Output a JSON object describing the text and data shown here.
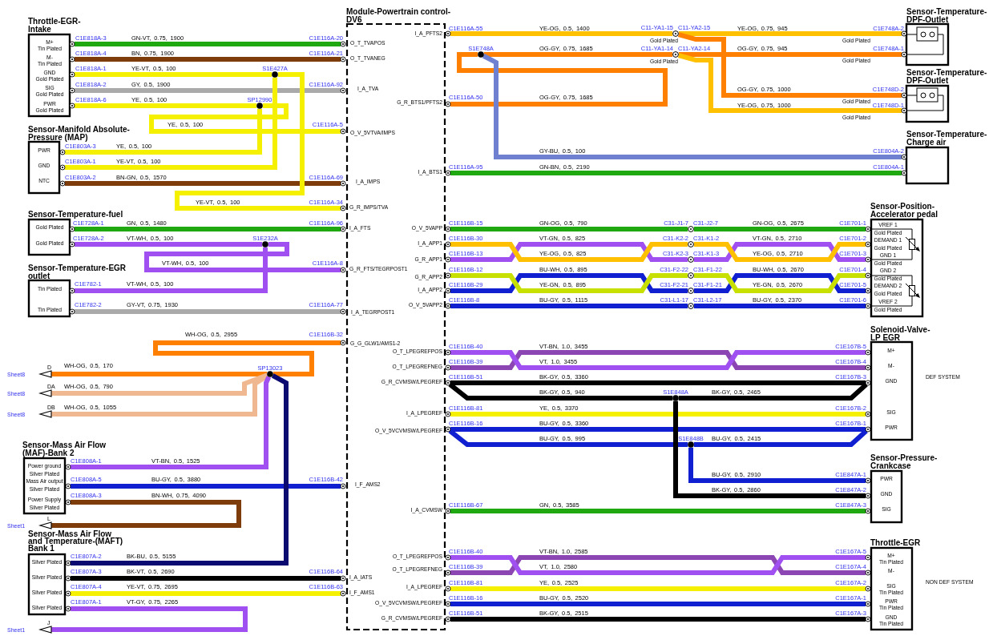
{
  "module": {
    "title_lines": [
      "Module-Powertrain control-",
      "DV6"
    ],
    "left_pins": [
      "O_T_TVAPOS",
      "O_T_TVANEG",
      "I_A_TVA",
      "O_V_5VTVA/IMPS",
      "I_A_IMPS",
      "G_R_IMPS/TVA",
      "I_A_FTS",
      "G_R_FTS/TEGRPOST1",
      "I_A_TEGRPOST1",
      "G_G_GLW1/AMS1-2",
      "I_F_AMS2",
      "I_A_IATS",
      "I_F_AMS1"
    ],
    "right_pins": [
      "I_A_PFTS2",
      "G_R_BTS1/PFTS2",
      "I_A_BTS1",
      "O_V_5VAPP",
      "I_A_APP1",
      "G_R_APP1",
      "G_R_APP2",
      "I_A_APP2",
      "O_V_5VAPP2",
      "O_T_LPEGREFPOS",
      "O_T_LPEGREFNEG",
      "G_R_CVMSW/LPEGREF",
      "I_A_LPEGREF",
      "O_V_5VCVMSW/LPEGREF",
      "I_A_CVMSW",
      "O_T_LPEGREFPOS",
      "O_T_LPEGREFNEG",
      "I_A_LPEGREF",
      "O_V_5VCVMSW/LPEGREF",
      "G_R_CVMSW/LPEGREF"
    ]
  },
  "components": [
    {
      "title_lines": [
        "Throttle-EGR-",
        "Intake"
      ],
      "pins": [
        {
          "name": "M+",
          "plating": "Tin Plated"
        },
        {
          "name": "M-",
          "plating": "Tin Plated"
        },
        {
          "name": "GND",
          "plating": "Gold Plated"
        },
        {
          "name": "SIG",
          "plating": "Gold Plated"
        },
        {
          "name": "PWR",
          "plating": "Gold Plated"
        }
      ]
    },
    {
      "title_lines": [
        "Sensor-Manifold Absolute-",
        "Pressure (MAP)"
      ],
      "pins": [
        {
          "name": "PWR"
        },
        {
          "name": "GND"
        },
        {
          "name": "NTC"
        }
      ]
    },
    {
      "title_lines": [
        "Sensor-Temperature-fuel"
      ],
      "pins": [
        {
          "plating": "Gold Plated"
        },
        {
          "plating": "Gold Plated"
        }
      ]
    },
    {
      "title_lines": [
        "Sensor-Temperature-EGR",
        "outlet"
      ],
      "pins": [
        {
          "plating": "Tin Plated"
        },
        {
          "plating": "Tin Plated"
        }
      ]
    },
    {
      "title_lines": [
        "Sensor-Mass Air Flow",
        "(MAF)-Bank 2"
      ],
      "pins": [
        {
          "name": "Power ground",
          "plating": "Silver Plated"
        },
        {
          "name": "Mass Air output",
          "plating": "Silver Plated"
        },
        {
          "name": "Power Supply",
          "plating": "Silver Plated"
        }
      ]
    },
    {
      "title_lines": [
        "Sensor-Mass Air Flow",
        "and Temperature-(MAFT)",
        "Bank 1"
      ],
      "pins": [
        {
          "plating": "Silver Plated"
        },
        {
          "plating": "Silver Plated"
        },
        {
          "plating": "Silver Plated"
        },
        {
          "plating": "Silver Plated"
        }
      ]
    },
    {
      "title_lines": [
        "Sensor-Temperature-",
        "DPF-Outlet"
      ]
    },
    {
      "title_lines": [
        "Sensor-Temperature-",
        "DPF-Outlet"
      ]
    },
    {
      "title_lines": [
        "Sensor-Temperature-",
        "Charge air"
      ]
    },
    {
      "title_lines": [
        "Sensor-Position-",
        "Accelerator pedal"
      ],
      "pins": [
        {
          "name": "VREF 1",
          "plating": "Gold Plated"
        },
        {
          "name": "DEMAND 1",
          "plating": "Gold Plated"
        },
        {
          "name": "GND 1",
          "plating": "Gold Plated"
        },
        {
          "name": "GND 2",
          "plating": "Gold Plated"
        },
        {
          "name": "DEMAND 2",
          "plating": "Gold Plated"
        },
        {
          "name": "VREF 2",
          "plating": "Gold Plated"
        }
      ]
    },
    {
      "title_lines": [
        "Solenoid-Valve-",
        "LP EGR"
      ],
      "pins": [
        {
          "name": "M+"
        },
        {
          "name": "M-"
        },
        {
          "name": "GND"
        },
        {
          "name": "SIG"
        },
        {
          "name": "PWR"
        }
      ],
      "note": "DEF SYSTEM"
    },
    {
      "title_lines": [
        "Sensor-Pressure-",
        "Crankcase"
      ],
      "pins": [
        {
          "name": "PWR"
        },
        {
          "name": "GND"
        },
        {
          "name": "SIG"
        }
      ]
    },
    {
      "title_lines": [
        "Throttle-EGR"
      ],
      "pins": [
        {
          "name": "M+",
          "plating": "Tin Plated"
        },
        {
          "name": "M-"
        },
        {
          "name": "SIG",
          "plating": "Tin Plated"
        },
        {
          "name": "PWR",
          "plating": "Tin Plated"
        },
        {
          "name": "GND",
          "plating": "Tin Plated"
        }
      ],
      "note": "NON DEF SYSTEM"
    }
  ],
  "wires": [
    {
      "from": "C1E818A-3",
      "spec": "GN-VT, 0.75, 1900",
      "to": "C1E116A-20",
      "color": "#20a810"
    },
    {
      "from": "C1E818A-4",
      "spec": "BN, 0.75, 1900",
      "to": "C1E116A-21",
      "color": "#7d3c0a"
    },
    {
      "from": "C1E818A-1",
      "spec": "YE-VT, 0.5, 100",
      "color": "#f5f000"
    },
    {
      "from": "C1E818A-2",
      "spec": "GY, 0.5, 1900",
      "to": "C1E116A-92",
      "color": "#aaaaaa"
    },
    {
      "from": "C1E818A-6",
      "spec": "YE, 0.5, 100",
      "color": "#f5f000"
    },
    {
      "spec": "YE, 0.5, 100",
      "to": "C1E116A-5",
      "color": "#f5f000"
    },
    {
      "from": "C1E803A-3",
      "spec": "YE, 0.5, 100",
      "color": "#f5f000"
    },
    {
      "from": "C1E803A-1",
      "spec": "YE-VT, 0.5, 100",
      "color": "#f5f000"
    },
    {
      "from": "C1E803A-2",
      "spec": "BN-GN, 0.5, 1570",
      "to": "C1E116A-69",
      "color": "#7d3c0a"
    },
    {
      "spec": "YE-VT, 0.5, 100",
      "to": "C1E116A-34",
      "color": "#f5f000"
    },
    {
      "from": "C1E728A-1",
      "spec": "GN, 0.5, 1480",
      "to": "C1E116A-96",
      "color": "#20a810"
    },
    {
      "from": "C1E728A-2",
      "spec": "VT-WH, 0.5, 100",
      "color": "#a050f0"
    },
    {
      "spec": "VT-WH, 0.5, 100",
      "to": "C1E116A-8",
      "color": "#a050f0"
    },
    {
      "from": "C1E782-1",
      "spec": "VT-WH, 0.5, 100",
      "color": "#a050f0"
    },
    {
      "from": "C1E782-2",
      "spec": "GY-VT, 0.75, 1930",
      "to": "C1E116A-77",
      "color": "#aaaaaa"
    },
    {
      "spec": "WH-OG, 0.5, 2955",
      "to": "C1E116B-32",
      "color": "#ff8000"
    },
    {
      "spec": "WH-OG, 0.5, 170",
      "color": "#ff8000"
    },
    {
      "spec": "WH-OG, 0.5, 790",
      "color": "#f0b890"
    },
    {
      "spec": "WH-OG, 0.5, 1055",
      "color": "#f0b890"
    },
    {
      "from": "C1E808A-1",
      "spec": "VT-BN, 0.5, 1525",
      "color": "#a050f0"
    },
    {
      "from": "C1E808A-5",
      "spec": "BU-GY, 0.5, 3880",
      "to": "C1E116B-42",
      "color": "#1020d0"
    },
    {
      "from": "C1E808A-3",
      "spec": "BN-WH, 0.75, 4090",
      "color": "#7d3c0a"
    },
    {
      "from": "C1E807A-2",
      "spec": "BK-BU, 0.5, 5155",
      "color": "#0a0a70"
    },
    {
      "from": "C1E807A-3",
      "spec": "BK-VT, 0.5, 2690",
      "to": "C1E116B-64",
      "color": "#000000"
    },
    {
      "from": "C1E807A-4",
      "spec": "YE-VT, 0.75, 2695",
      "to": "C1E116B-63",
      "color": "#f5f000"
    },
    {
      "from": "C1E807A-1",
      "spec": "VT-GY, 0.75, 2265",
      "color": "#a050f0"
    },
    {
      "from": "C1E116A-55",
      "spec": "YE-OG, 0.5, 1400",
      "color": "#ffc000"
    },
    {
      "spec": "YE-OG, 0.75, 945",
      "to": "C1E748A-2",
      "to_plating": "Gold Plated",
      "color": "#ffc000"
    },
    {
      "spec": "OG-GY, 0.75, 1685",
      "color": "#ff8000"
    },
    {
      "spec": "OG-GY, 0.75, 945",
      "to": "C1E748A-1",
      "to_plating": "Gold Plated",
      "color": "#ff8000"
    },
    {
      "from": "C1E116A-50",
      "spec": "OG-GY, 0.75, 1685",
      "color": "#ff8000"
    },
    {
      "spec": "OG-GY, 0.75, 1000",
      "to": "C1E748D-2",
      "to_plating": "Gold Plated",
      "color": "#ff8000"
    },
    {
      "spec": "YE-OG, 0.75, 1000",
      "to": "C1E748D-1",
      "to_plating": "Gold Plated",
      "color": "#ffc000"
    },
    {
      "spec": "GY-BU, 0.5, 100",
      "to": "C1E804A-2",
      "color": "#7080d0"
    },
    {
      "from": "C1E116A-95",
      "spec": "GN-BN, 0.5, 2190",
      "to": "C1E804A-1",
      "color": "#20a810"
    },
    {
      "from": "C1E116B-15",
      "spec": "GN-OG, 0.5, 790",
      "color": "#20a810"
    },
    {
      "spec": "GN-OG, 0.5, 2675",
      "to": "C1E701-1",
      "color": "#20a810"
    },
    {
      "from": "C1E116B-30",
      "spec": "VT-GN, 0.5, 825",
      "color": "#a050f0"
    },
    {
      "spec": "VT-GN, 0.5, 2710",
      "to": "C1E701-2",
      "color": "#a050f0"
    },
    {
      "from": "C1E116B-13",
      "spec": "YE-OG, 0.5, 825",
      "color": "#ffc000"
    },
    {
      "spec": "YE-OG, 0.5, 2710",
      "to": "C1E701-3",
      "color": "#ffc000"
    },
    {
      "from": "C1E116B-12",
      "spec": "BU-WH, 0.5, 895",
      "color": "#1020d0"
    },
    {
      "spec": "BU-WH, 0.5, 2670",
      "to": "C1E701-4",
      "color": "#1020d0"
    },
    {
      "from": "C1E116B-29",
      "spec": "YE-GN, 0.5, 895",
      "color": "#c8e000"
    },
    {
      "spec": "YE-GN, 0.5, 2670",
      "to": "C1E701-5",
      "color": "#c8e000"
    },
    {
      "from": "C1E116B-8",
      "spec": "BU-GY, 0.5, 1115",
      "color": "#1020d0"
    },
    {
      "spec": "BU-GY, 0.5, 2370",
      "to": "C1E701-6",
      "color": "#1020d0"
    },
    {
      "from": "C1E116B-40",
      "spec": "VT-BN, 1.0, 3455",
      "to": "C1E167B-5",
      "color": "#8c46b4"
    },
    {
      "from": "C1E116B-39",
      "spec": "VT, 1.0, 3455",
      "to": "C1E167B-4",
      "color": "#a050f0"
    },
    {
      "from": "C1E116B-51",
      "spec": "BK-GY, 0.5, 3360",
      "to": "C1E167B-3",
      "color": "#000000"
    },
    {
      "spec": "BK-GY, 0.5, 940",
      "color": "#000000"
    },
    {
      "spec": "BK-GY, 0.5, 2465",
      "color": "#000000"
    },
    {
      "from": "C1E116B-81",
      "spec": "YE, 0.5, 3370",
      "to": "C1E167B-2",
      "color": "#f5f000"
    },
    {
      "from": "C1E116B-16",
      "spec": "BU-GY, 0.5, 3360",
      "to": "C1E167B-1",
      "color": "#1020d0"
    },
    {
      "spec": "BU-GY, 0.5, 995",
      "color": "#1020d0"
    },
    {
      "spec": "BU-GY, 0.5, 2415",
      "color": "#1020d0"
    },
    {
      "spec": "BU-GY, 0.5, 2910",
      "to": "C1E847A-1",
      "color": "#1020d0"
    },
    {
      "spec": "BK-GY, 0.5, 2860",
      "to": "C1E847A-2",
      "color": "#000000"
    },
    {
      "from": "C1E116B-67",
      "spec": "GN, 0.5, 3585",
      "to": "C1E847A-3",
      "color": "#20a810"
    },
    {
      "from": "C1E116B-40",
      "spec": "VT-BN, 1.0, 2585",
      "to": "C1E167A-5",
      "color": "#8c46b4"
    },
    {
      "from": "C1E116B-39",
      "spec": "VT, 1.0, 2580",
      "to": "C1E167A-4",
      "color": "#a050f0"
    },
    {
      "from": "C1E116B-81",
      "spec": "YE, 0.5, 2525",
      "to": "C1E167A-2",
      "color": "#f5f000"
    },
    {
      "from": "C1E116B-16",
      "spec": "BU-GY, 0.5, 2520",
      "to": "C1E167A-1",
      "color": "#1020d0"
    },
    {
      "from": "C1E116B-51",
      "spec": "BK-GY, 0.5, 2515",
      "to": "C1E167A-3",
      "color": "#000000"
    }
  ],
  "splices": [
    {
      "label": "S1E427A"
    },
    {
      "label": "SP12990"
    },
    {
      "label": "S1E232A"
    },
    {
      "label": "SP13023"
    },
    {
      "label": "S1E748A"
    },
    {
      "label": "S1E848A"
    },
    {
      "label": "S1E848B"
    }
  ],
  "inline_connectors": [
    {
      "left": "C11-YA1-15",
      "right": "C11-YA2-15",
      "plating": "Gold Plated"
    },
    {
      "left": "C11-YA1-14",
      "right": "C11-YA2-14",
      "plating": "Gold Plated"
    },
    {
      "left": "C31-J1-7",
      "right": "C31-J2-7"
    },
    {
      "left": "C31-K2-2",
      "right": "C31-K1-2"
    },
    {
      "left": "C31-K2-3",
      "right": "C31-K1-3"
    },
    {
      "left": "C31-F2-22",
      "right": "C31-F1-22"
    },
    {
      "left": "C31-F2-21",
      "right": "C31-F1-21"
    },
    {
      "left": "C31-L1-17",
      "right": "C31-L2-17"
    }
  ],
  "sheet_refs": [
    {
      "sheet": "Sheet8",
      "pin": "D"
    },
    {
      "sheet": "Sheet8",
      "pin": "DA"
    },
    {
      "sheet": "Sheet8",
      "pin": "DB"
    },
    {
      "sheet": "Sheet1",
      "pin": "L"
    },
    {
      "sheet": "Sheet1",
      "pin": "J"
    }
  ]
}
